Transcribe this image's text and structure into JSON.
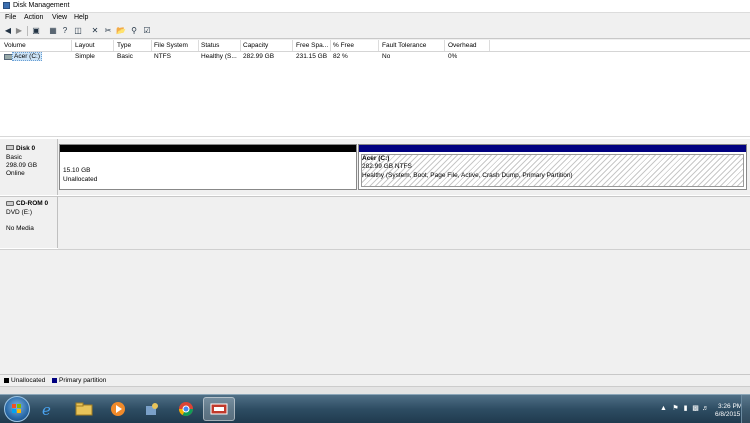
{
  "window": {
    "title": "Disk Management"
  },
  "menu": [
    "File",
    "Action",
    "View",
    "Help"
  ],
  "toolbar_icons": [
    "back-arrow-icon",
    "forward-arrow-icon",
    "show-hide-pane-icon",
    "properties-icon",
    "help-icon",
    "delete-icon",
    "cut-icon",
    "open-folder-icon",
    "search-icon",
    "checklist-icon"
  ],
  "volume_list": {
    "columns": [
      "Volume",
      "Layout",
      "Type",
      "File System",
      "Status",
      "Capacity",
      "Free Spa...",
      "% Free",
      "Fault Tolerance",
      "Overhead"
    ],
    "rows": [
      {
        "volume": "Acer (C:)",
        "layout": "Simple",
        "type": "Basic",
        "fs": "NTFS",
        "status": "Healthy (S...",
        "capacity": "282.99 GB",
        "free": "231.15 GB",
        "pct": "82 %",
        "fault": "No",
        "overhead": "0%"
      }
    ]
  },
  "disks": [
    {
      "name": "Disk 0",
      "type": "Basic",
      "size": "298.09 GB",
      "state": "Online",
      "partitions": [
        {
          "kind": "unallocated",
          "size": "15.10 GB",
          "label": "Unallocated"
        },
        {
          "kind": "primary",
          "title": "Acer  (C:)",
          "size": "282.99 GB NTFS",
          "status": "Healthy (System, Boot, Page File, Active, Crash Dump, Primary Partition)"
        }
      ]
    },
    {
      "name": "CD-ROM 0",
      "type": "DVD (E:)",
      "state": "No Media"
    }
  ],
  "legend": [
    {
      "label": "Unallocated",
      "color": "#000000"
    },
    {
      "label": "Primary partition",
      "color": "#000080"
    }
  ],
  "taskbar": {
    "apps": [
      "start-button",
      "internet-explorer",
      "file-explorer",
      "media-player",
      "user-admin-tool",
      "chrome",
      "disk-management"
    ],
    "time": "3:26 PM",
    "date": "6/8/2015"
  },
  "colors": {
    "unallocated": "#000000",
    "primary": "#000080",
    "selection": "#cde4f7"
  }
}
